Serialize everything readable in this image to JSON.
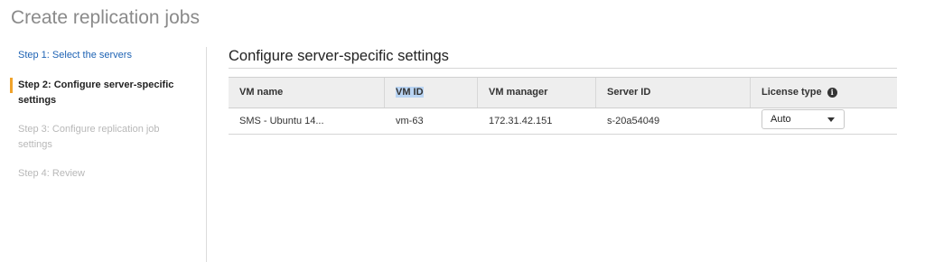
{
  "page": {
    "title": "Create replication jobs"
  },
  "steps": [
    {
      "label": "Step 1: Select the servers"
    },
    {
      "label": "Step 2: Configure server-specific settings"
    },
    {
      "label": "Step 3: Configure replication job settings"
    },
    {
      "label": "Step 4: Review"
    }
  ],
  "section": {
    "title": "Configure server-specific settings"
  },
  "table": {
    "columns": [
      "VM name",
      "VM ID",
      "VM manager",
      "Server ID",
      "License type"
    ],
    "rows": [
      {
        "vm_name": "SMS - Ubuntu 14...",
        "vm_id": "vm-63",
        "vm_manager": "172.31.42.151",
        "server_id": "s-20a54049",
        "license_type": "Auto"
      }
    ],
    "info_icon": "info-icon"
  },
  "colors": {
    "active_step_marker": "#f0a32b",
    "link": "#1e63b4",
    "disabled": "#b8b8b8",
    "header_bg": "#eeeeee"
  }
}
